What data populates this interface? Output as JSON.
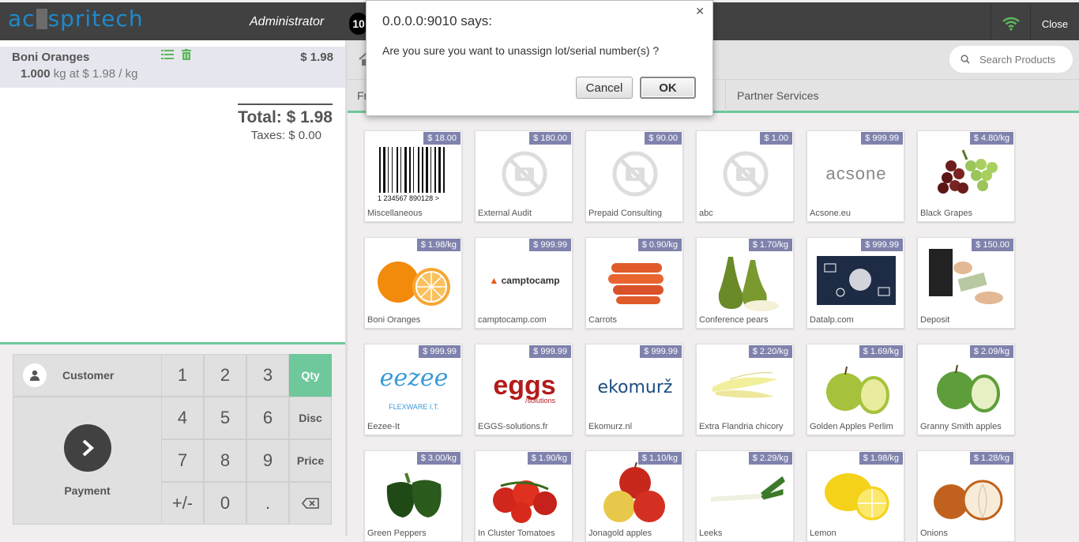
{
  "header": {
    "logo_text": "acespritech",
    "user": "Administrator",
    "order_number": "10",
    "close_label": "Close"
  },
  "order": {
    "line": {
      "name": "Boni Oranges",
      "price": "$ 1.98",
      "qty": "1.000",
      "unit_info": "kg at $ 1.98 / kg"
    },
    "total": "Total: $ 1.98",
    "taxes": "Taxes: $ 0.00"
  },
  "numpad": {
    "customer": "Customer",
    "payment": "Payment",
    "keys": [
      "1",
      "2",
      "3",
      "4",
      "5",
      "6",
      "7",
      "8",
      "9",
      "+/-",
      "0",
      "."
    ],
    "modes": [
      "Qty",
      "Disc",
      "Price"
    ]
  },
  "search": {
    "placeholder": "Search Products"
  },
  "categories": {
    "first": "Fr",
    "partner": "Partner Services"
  },
  "products": [
    {
      "name": "Miscellaneous",
      "price": "$ 18.00",
      "img": "barcode"
    },
    {
      "name": "External Audit",
      "price": "$ 180.00",
      "img": "noimage"
    },
    {
      "name": "Prepaid Consulting",
      "price": "$ 90.00",
      "img": "noimage"
    },
    {
      "name": "abc",
      "price": "$ 1.00",
      "img": "noimage"
    },
    {
      "name": "Acsone.eu",
      "price": "$ 999.99",
      "img": "acsone"
    },
    {
      "name": "Black Grapes",
      "price": "$ 4.80/kg",
      "img": "grapes"
    },
    {
      "name": "Boni Oranges",
      "price": "$ 1.98/kg",
      "img": "oranges"
    },
    {
      "name": "camptocamp.com",
      "price": "$ 999.99",
      "img": "camptocamp"
    },
    {
      "name": "Carrots",
      "price": "$ 0.90/kg",
      "img": "carrots"
    },
    {
      "name": "Conference pears",
      "price": "$ 1.70/kg",
      "img": "pears"
    },
    {
      "name": "Datalp.com",
      "price": "$ 999.99",
      "img": "datalp"
    },
    {
      "name": "Deposit",
      "price": "$ 150.00",
      "img": "deposit"
    },
    {
      "name": "Eezee-It",
      "price": "$ 999.99",
      "img": "eezee"
    },
    {
      "name": "EGGS-solutions.fr",
      "price": "$ 999.99",
      "img": "eggs"
    },
    {
      "name": "Ekomurz.nl",
      "price": "$ 999.99",
      "img": "ekomurz"
    },
    {
      "name": "Extra Flandria chicory",
      "price": "$ 2.20/kg",
      "img": "chicory"
    },
    {
      "name": "Golden Apples Perlim",
      "price": "$ 1.69/kg",
      "img": "golden"
    },
    {
      "name": "Granny Smith apples",
      "price": "$ 2.09/kg",
      "img": "granny"
    },
    {
      "name": "Green Peppers",
      "price": "$ 3.00/kg",
      "img": "peppers"
    },
    {
      "name": "In Cluster Tomatoes",
      "price": "$ 1.90/kg",
      "img": "tomatoes"
    },
    {
      "name": "Jonagold apples",
      "price": "$ 1.10/kg",
      "img": "jonagold"
    },
    {
      "name": "Leeks",
      "price": "$ 2.29/kg",
      "img": "leeks"
    },
    {
      "name": "Lemon",
      "price": "$ 1.98/kg",
      "img": "lemon"
    },
    {
      "name": "Onions",
      "price": "$ 1.28/kg",
      "img": "onions"
    }
  ],
  "brand_text": {
    "acsone": "acsone",
    "camptocamp": "camptocamp",
    "eezee": "eezee",
    "eezee_sub": "FLEXWARE I.T.",
    "eggs": "eggs",
    "eggs_sub": "/solutions",
    "ekomurz": "ekomurž"
  },
  "dialog": {
    "title": "0.0.0.0:9010 says:",
    "message": "Are you sure you want to unassign lot/serial number(s) ?",
    "cancel": "Cancel",
    "ok": "OK"
  },
  "colors": {
    "accent": "#6ec89b",
    "price_tag": "#7f82ac",
    "header": "#414141"
  }
}
